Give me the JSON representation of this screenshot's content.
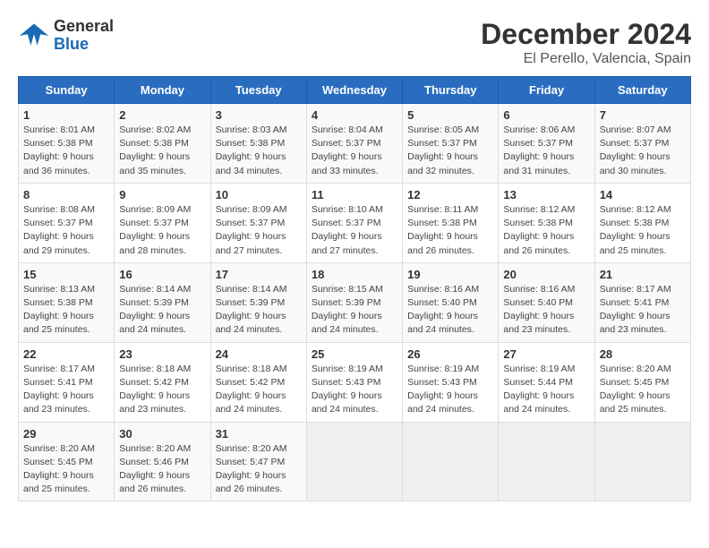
{
  "header": {
    "logo_general": "General",
    "logo_blue": "Blue",
    "month_title": "December 2024",
    "location": "El Perello, Valencia, Spain"
  },
  "calendar": {
    "days_of_week": [
      "Sunday",
      "Monday",
      "Tuesday",
      "Wednesday",
      "Thursday",
      "Friday",
      "Saturday"
    ],
    "weeks": [
      [
        {
          "day": "1",
          "sunrise": "8:01 AM",
          "sunset": "5:38 PM",
          "daylight": "9 hours and 36 minutes."
        },
        {
          "day": "2",
          "sunrise": "8:02 AM",
          "sunset": "5:38 PM",
          "daylight": "9 hours and 35 minutes."
        },
        {
          "day": "3",
          "sunrise": "8:03 AM",
          "sunset": "5:38 PM",
          "daylight": "9 hours and 34 minutes."
        },
        {
          "day": "4",
          "sunrise": "8:04 AM",
          "sunset": "5:37 PM",
          "daylight": "9 hours and 33 minutes."
        },
        {
          "day": "5",
          "sunrise": "8:05 AM",
          "sunset": "5:37 PM",
          "daylight": "9 hours and 32 minutes."
        },
        {
          "day": "6",
          "sunrise": "8:06 AM",
          "sunset": "5:37 PM",
          "daylight": "9 hours and 31 minutes."
        },
        {
          "day": "7",
          "sunrise": "8:07 AM",
          "sunset": "5:37 PM",
          "daylight": "9 hours and 30 minutes."
        }
      ],
      [
        {
          "day": "8",
          "sunrise": "8:08 AM",
          "sunset": "5:37 PM",
          "daylight": "9 hours and 29 minutes."
        },
        {
          "day": "9",
          "sunrise": "8:09 AM",
          "sunset": "5:37 PM",
          "daylight": "9 hours and 28 minutes."
        },
        {
          "day": "10",
          "sunrise": "8:09 AM",
          "sunset": "5:37 PM",
          "daylight": "9 hours and 27 minutes."
        },
        {
          "day": "11",
          "sunrise": "8:10 AM",
          "sunset": "5:37 PM",
          "daylight": "9 hours and 27 minutes."
        },
        {
          "day": "12",
          "sunrise": "8:11 AM",
          "sunset": "5:38 PM",
          "daylight": "9 hours and 26 minutes."
        },
        {
          "day": "13",
          "sunrise": "8:12 AM",
          "sunset": "5:38 PM",
          "daylight": "9 hours and 26 minutes."
        },
        {
          "day": "14",
          "sunrise": "8:12 AM",
          "sunset": "5:38 PM",
          "daylight": "9 hours and 25 minutes."
        }
      ],
      [
        {
          "day": "15",
          "sunrise": "8:13 AM",
          "sunset": "5:38 PM",
          "daylight": "9 hours and 25 minutes."
        },
        {
          "day": "16",
          "sunrise": "8:14 AM",
          "sunset": "5:39 PM",
          "daylight": "9 hours and 24 minutes."
        },
        {
          "day": "17",
          "sunrise": "8:14 AM",
          "sunset": "5:39 PM",
          "daylight": "9 hours and 24 minutes."
        },
        {
          "day": "18",
          "sunrise": "8:15 AM",
          "sunset": "5:39 PM",
          "daylight": "9 hours and 24 minutes."
        },
        {
          "day": "19",
          "sunrise": "8:16 AM",
          "sunset": "5:40 PM",
          "daylight": "9 hours and 24 minutes."
        },
        {
          "day": "20",
          "sunrise": "8:16 AM",
          "sunset": "5:40 PM",
          "daylight": "9 hours and 23 minutes."
        },
        {
          "day": "21",
          "sunrise": "8:17 AM",
          "sunset": "5:41 PM",
          "daylight": "9 hours and 23 minutes."
        }
      ],
      [
        {
          "day": "22",
          "sunrise": "8:17 AM",
          "sunset": "5:41 PM",
          "daylight": "9 hours and 23 minutes."
        },
        {
          "day": "23",
          "sunrise": "8:18 AM",
          "sunset": "5:42 PM",
          "daylight": "9 hours and 23 minutes."
        },
        {
          "day": "24",
          "sunrise": "8:18 AM",
          "sunset": "5:42 PM",
          "daylight": "9 hours and 24 minutes."
        },
        {
          "day": "25",
          "sunrise": "8:19 AM",
          "sunset": "5:43 PM",
          "daylight": "9 hours and 24 minutes."
        },
        {
          "day": "26",
          "sunrise": "8:19 AM",
          "sunset": "5:43 PM",
          "daylight": "9 hours and 24 minutes."
        },
        {
          "day": "27",
          "sunrise": "8:19 AM",
          "sunset": "5:44 PM",
          "daylight": "9 hours and 24 minutes."
        },
        {
          "day": "28",
          "sunrise": "8:20 AM",
          "sunset": "5:45 PM",
          "daylight": "9 hours and 25 minutes."
        }
      ],
      [
        {
          "day": "29",
          "sunrise": "8:20 AM",
          "sunset": "5:45 PM",
          "daylight": "9 hours and 25 minutes."
        },
        {
          "day": "30",
          "sunrise": "8:20 AM",
          "sunset": "5:46 PM",
          "daylight": "9 hours and 26 minutes."
        },
        {
          "day": "31",
          "sunrise": "8:20 AM",
          "sunset": "5:47 PM",
          "daylight": "9 hours and 26 minutes."
        },
        null,
        null,
        null,
        null
      ]
    ]
  }
}
